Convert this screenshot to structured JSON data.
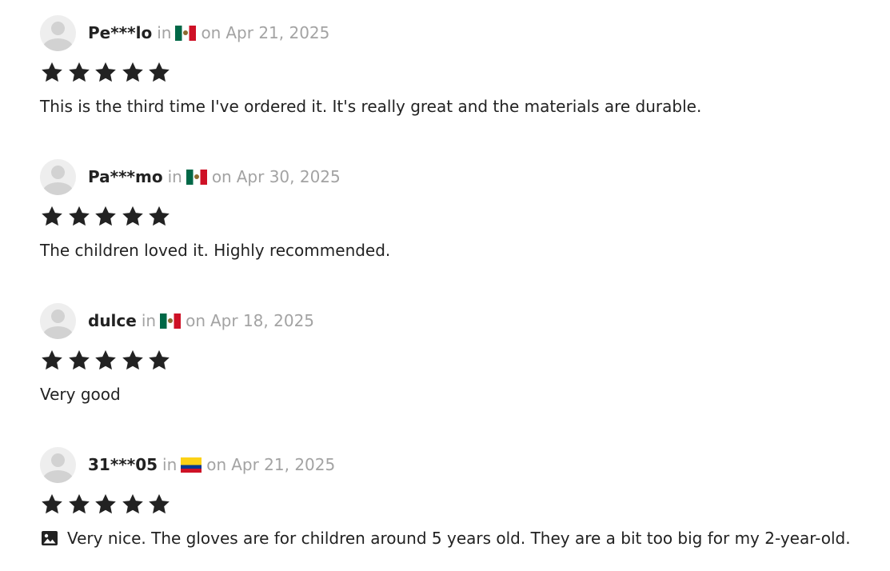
{
  "reviews": [
    {
      "username": "Pe***lo",
      "in_label": "in",
      "country": "Mexico",
      "flag": "flag-mx",
      "date_prefix": "on",
      "date": "Apr 21, 2025",
      "rating": 5,
      "text": "This is the third time I've ordered it. It's really great and the materials are durable.",
      "has_image": false
    },
    {
      "username": "Pa***mo",
      "in_label": "in",
      "country": "Mexico",
      "flag": "flag-mx",
      "date_prefix": "on",
      "date": "Apr 30, 2025",
      "rating": 5,
      "text": "The children loved it. Highly recommended.",
      "has_image": false
    },
    {
      "username": "dulce",
      "in_label": "in",
      "country": "Mexico",
      "flag": "flag-mx",
      "date_prefix": "on",
      "date": "Apr 18, 2025",
      "rating": 5,
      "text": "Very good",
      "has_image": false
    },
    {
      "username": "31***05",
      "in_label": "in",
      "country": "Colombia",
      "flag": "flag-co",
      "date_prefix": "on",
      "date": "Apr 21, 2025",
      "rating": 5,
      "text": "Very nice. The gloves are for children around 5 years old. They are a bit too big for my 2-year-old.",
      "has_image": true
    }
  ],
  "colors": {
    "text": "#222222",
    "muted": "#a3a3a3",
    "star": "#222222",
    "avatar_bg": "#eeeeee",
    "avatar_fg": "#d2d2d2"
  },
  "icons": {
    "avatar": "user-avatar-icon",
    "star": "star-icon",
    "image": "image-icon"
  }
}
